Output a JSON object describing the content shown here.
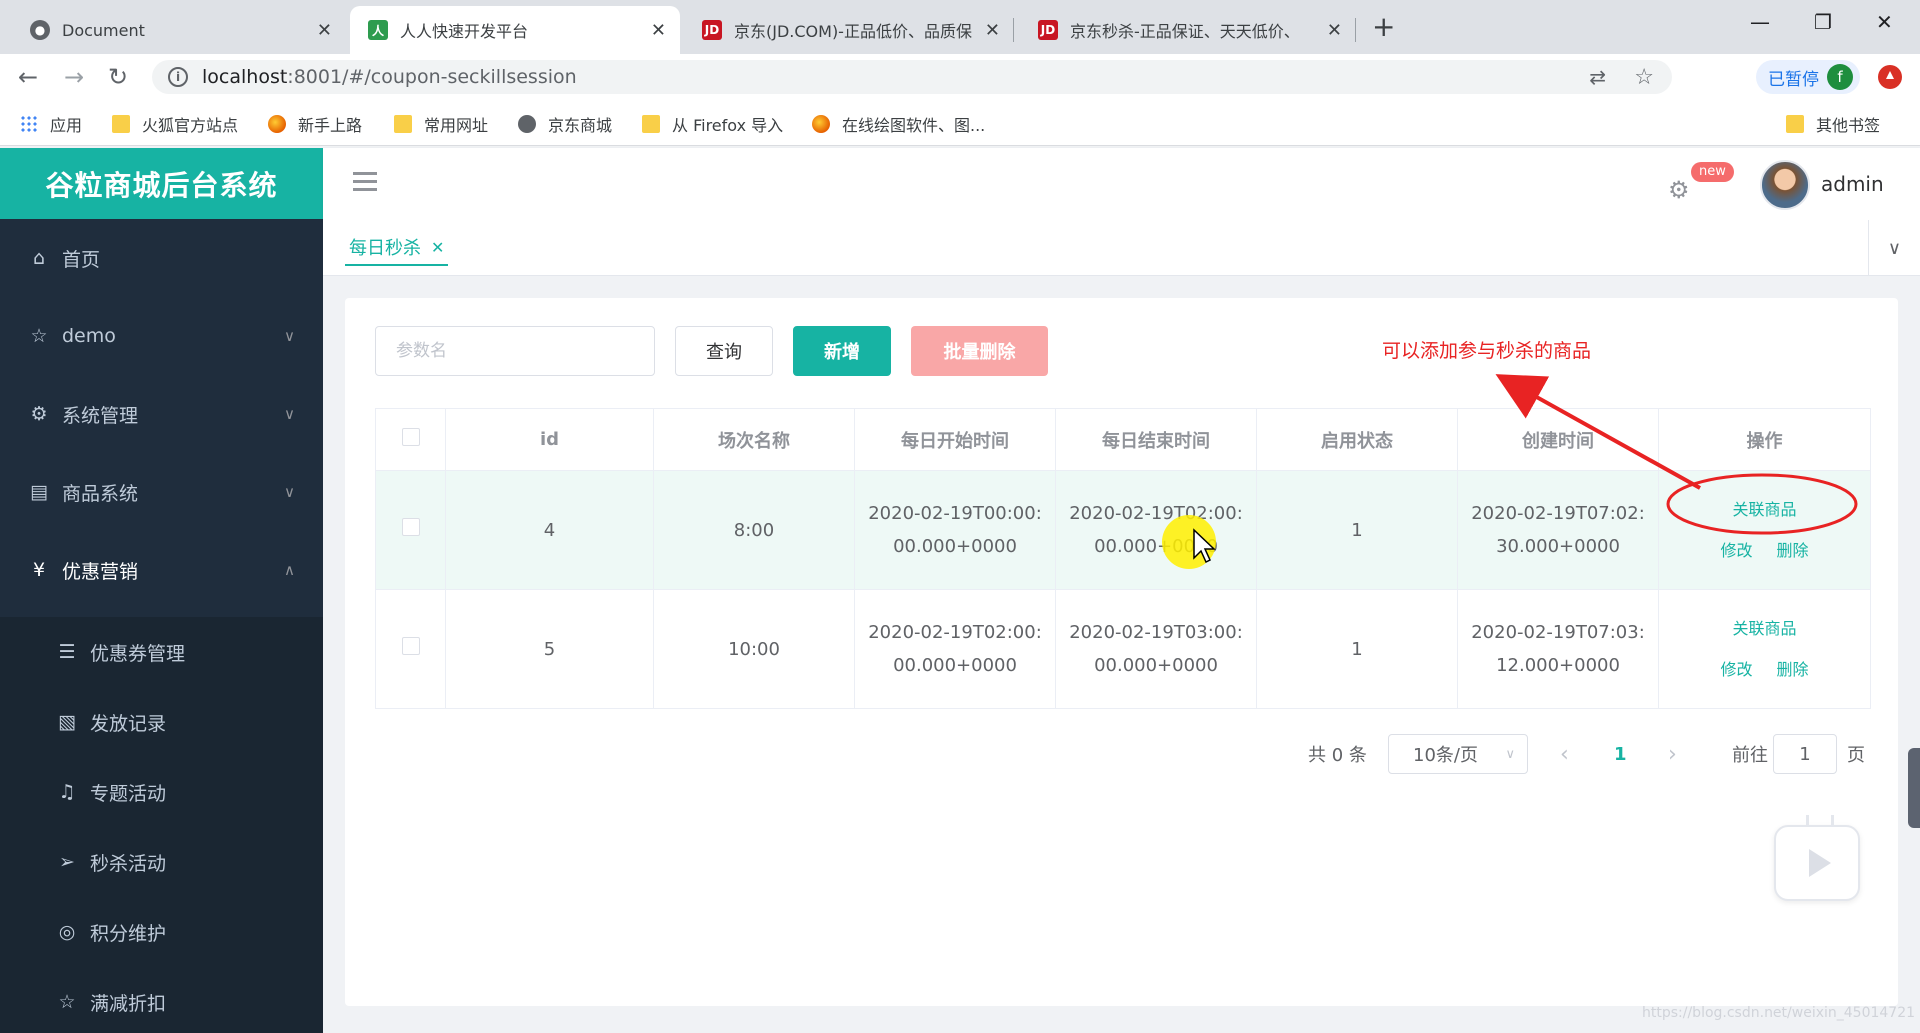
{
  "browser": {
    "tabs": [
      {
        "title": "Document",
        "icon": "globe-icon"
      },
      {
        "title": "人人快速开发平台",
        "icon": "renren-logo-icon",
        "active": true
      },
      {
        "title": "京东(JD.COM)-正品低价、品质保",
        "icon": "jd-logo-icon"
      },
      {
        "title": "京东秒杀-正品保证、天天低价、",
        "icon": "jd-logo-icon"
      }
    ],
    "url_host": "localhost",
    "url_path": ":8001/#/coupon-seckillsession",
    "profile_label": "已暂停",
    "profile_initial": "f",
    "bookmarks": [
      "应用",
      "火狐官方站点",
      "新手上路",
      "常用网址",
      "京东商城",
      "从 Firefox 导入",
      "在线绘图软件、图...",
      "其他书签"
    ]
  },
  "app": {
    "brand": "谷粒商城后台系统",
    "user": "admin",
    "new_badge": "new",
    "accent": "#17b3a3",
    "sidebar": {
      "items": [
        {
          "label": "首页",
          "icon": "home-icon"
        },
        {
          "label": "demo",
          "icon": "star-icon",
          "chevron": "down"
        },
        {
          "label": "系统管理",
          "icon": "gear-icon",
          "chevron": "down"
        },
        {
          "label": "商品系统",
          "icon": "document-icon",
          "chevron": "down"
        },
        {
          "label": "优惠营销",
          "icon": "coupon-icon",
          "chevron": "up"
        }
      ],
      "subitems": [
        {
          "label": "优惠券管理",
          "icon": "menu-icon"
        },
        {
          "label": "发放记录",
          "icon": "record-icon"
        },
        {
          "label": "专题活动",
          "icon": "bell-icon"
        },
        {
          "label": "秒杀活动",
          "icon": "send-icon"
        },
        {
          "label": "积分维护",
          "icon": "points-icon"
        },
        {
          "label": "满减折扣",
          "icon": "star-icon"
        }
      ]
    },
    "tab": "每日秒杀",
    "toolbar": {
      "search_placeholder": "参数名",
      "query": "查询",
      "add": "新增",
      "batch_delete": "批量删除"
    },
    "annotation": "可以添加参与秒杀的商品",
    "table": {
      "headers": [
        "id",
        "场次名称",
        "每日开始时间",
        "每日结束时间",
        "启用状态",
        "创建时间",
        "操作"
      ],
      "actions": {
        "relate": "关联商品",
        "edit": "修改",
        "delete": "删除"
      },
      "rows": [
        {
          "id": "4",
          "name": "8:00",
          "start_1": "2020-02-19T00:00:",
          "start_2": "00.000+0000",
          "end_1": "2020-02-19T02:00:",
          "end_2": "00.000+0000",
          "status": "1",
          "created_1": "2020-02-19T07:02:",
          "created_2": "30.000+0000"
        },
        {
          "id": "5",
          "name": "10:00",
          "start_1": "2020-02-19T02:00:",
          "start_2": "00.000+0000",
          "end_1": "2020-02-19T03:00:",
          "end_2": "00.000+0000",
          "status": "1",
          "created_1": "2020-02-19T07:03:",
          "created_2": "12.000+0000"
        }
      ]
    },
    "pagination": {
      "total": "共 0 条",
      "page_size": "10条/页",
      "current_page": "1",
      "goto_label": "前往",
      "goto_value": "1",
      "page_unit": "页"
    }
  },
  "watermark": "https://blog.csdn.net/weixin_45014721"
}
